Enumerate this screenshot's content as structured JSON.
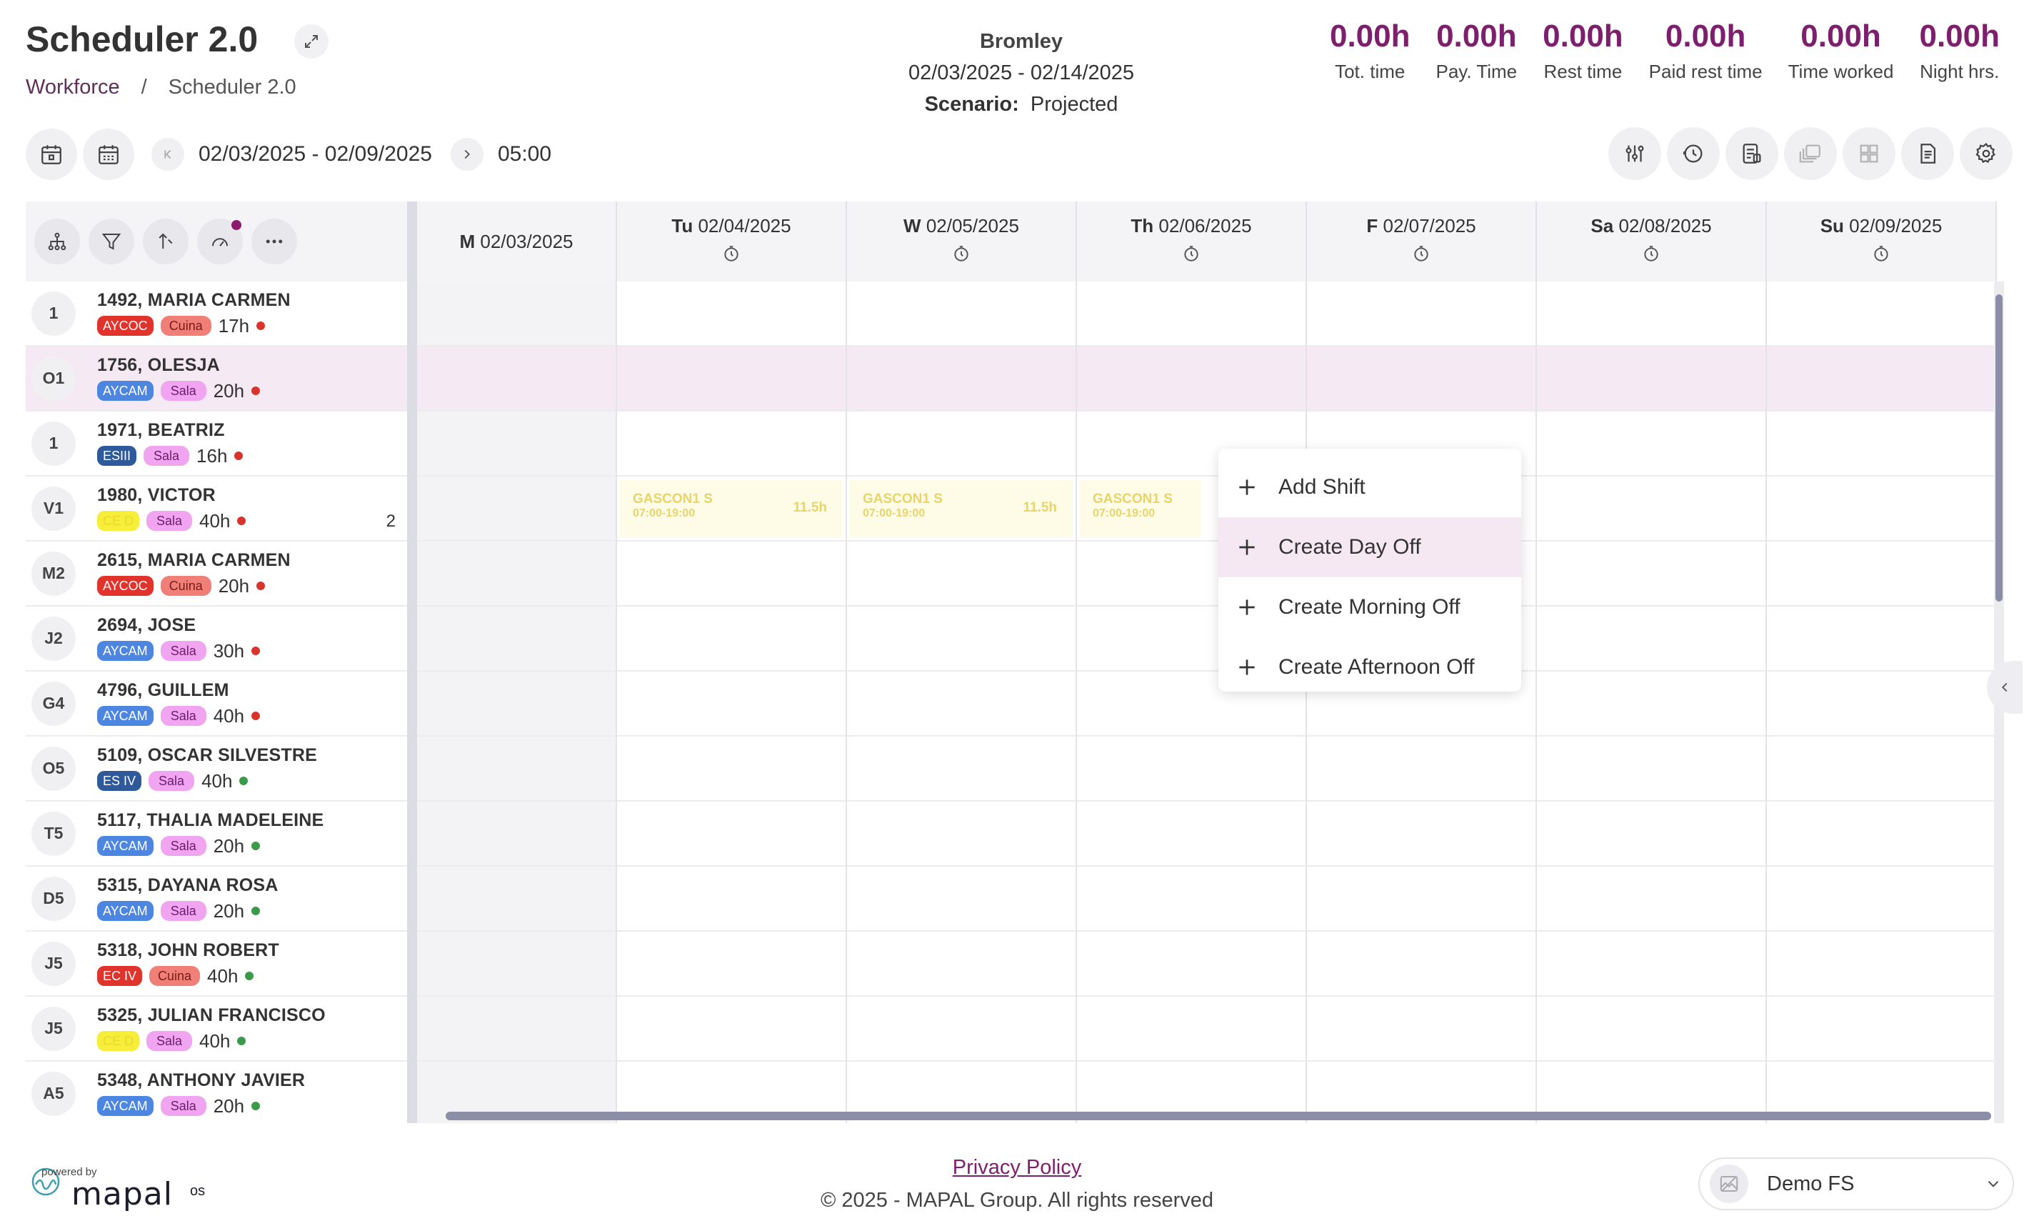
{
  "header": {
    "title": "Scheduler 2.0",
    "breadcrumb": [
      "Workforce",
      "/",
      "Scheduler 2.0"
    ],
    "location": "Bromley",
    "period": "02/03/2025 - 02/14/2025",
    "scenario_label": "Scenario:",
    "scenario_value": "Projected"
  },
  "stats": [
    {
      "value": "0.00h",
      "label": "Tot. time"
    },
    {
      "value": "0.00h",
      "label": "Pay. Time"
    },
    {
      "value": "0.00h",
      "label": "Rest time"
    },
    {
      "value": "0.00h",
      "label": "Paid rest time"
    },
    {
      "value": "0.00h",
      "label": "Time worked"
    },
    {
      "value": "0.00h",
      "label": "Night hrs."
    }
  ],
  "toolbar": {
    "week_range": "02/03/2025 - 02/09/2025",
    "time": "05:00",
    "right_icons": [
      "sliders-icon",
      "history-icon",
      "report-icon",
      "copy-icon",
      "grid-icon",
      "document-icon",
      "gear-icon"
    ]
  },
  "days": [
    {
      "abbr": "M",
      "date": "02/03/2025"
    },
    {
      "abbr": "Tu",
      "date": "02/04/2025"
    },
    {
      "abbr": "W",
      "date": "02/05/2025"
    },
    {
      "abbr": "Th",
      "date": "02/06/2025"
    },
    {
      "abbr": "F",
      "date": "02/07/2025"
    },
    {
      "abbr": "Sa",
      "date": "02/08/2025"
    },
    {
      "abbr": "Su",
      "date": "02/09/2025"
    }
  ],
  "employees": [
    {
      "initials": "1",
      "name": "1492, MARIA CARMEN",
      "tag": "AYCOC",
      "dept": "Cuina",
      "hours": "17h",
      "status": "red"
    },
    {
      "initials": "O1",
      "name": "1756, OLESJA",
      "tag": "AYCAM",
      "dept": "Sala",
      "hours": "20h",
      "status": "red"
    },
    {
      "initials": "1",
      "name": "1971, BEATRIZ",
      "tag": "ESIII",
      "dept": "Sala",
      "hours": "16h",
      "status": "red"
    },
    {
      "initials": "V1",
      "name": "1980, VICTOR",
      "tag": "CE D",
      "dept": "Sala",
      "hours": "40h",
      "status": "red",
      "extra": "2"
    },
    {
      "initials": "M2",
      "name": "2615, MARIA CARMEN",
      "tag": "AYCOC",
      "dept": "Cuina",
      "hours": "20h",
      "status": "red"
    },
    {
      "initials": "J2",
      "name": "2694, JOSE",
      "tag": "AYCAM",
      "dept": "Sala",
      "hours": "30h",
      "status": "red"
    },
    {
      "initials": "G4",
      "name": "4796, GUILLEM",
      "tag": "AYCAM",
      "dept": "Sala",
      "hours": "40h",
      "status": "red"
    },
    {
      "initials": "O5",
      "name": "5109, OSCAR SILVESTRE",
      "tag": "ES IV",
      "dept": "Sala",
      "hours": "40h",
      "status": "green"
    },
    {
      "initials": "T5",
      "name": "5117, THALIA MADELEINE",
      "tag": "AYCAM",
      "dept": "Sala",
      "hours": "20h",
      "status": "green"
    },
    {
      "initials": "D5",
      "name": "5315, DAYANA ROSA",
      "tag": "AYCAM",
      "dept": "Sala",
      "hours": "20h",
      "status": "green"
    },
    {
      "initials": "J5",
      "name": "5318, JOHN ROBERT",
      "tag": "EC IV",
      "dept": "Cuina",
      "hours": "40h",
      "status": "green"
    },
    {
      "initials": "J5",
      "name": "5325, JULIAN FRANCISCO",
      "tag": "CE D",
      "dept": "Sala",
      "hours": "40h",
      "status": "green"
    },
    {
      "initials": "A5",
      "name": "5348, ANTHONY JAVIER",
      "tag": "AYCAM",
      "dept": "Sala",
      "hours": "20h",
      "status": "green"
    }
  ],
  "shifts": [
    {
      "name": "GASCON1 S",
      "time": "07:00-19:00",
      "duration": "11.5h"
    },
    {
      "name": "GASCON1 S",
      "time": "07:00-19:00",
      "duration": "11.5h"
    },
    {
      "name": "GASCON1 S",
      "time": "07:00-19:00",
      "duration": ""
    }
  ],
  "context_menu": [
    "Add Shift",
    "Create Day Off",
    "Create Morning Off",
    "Create Afternoon Off"
  ],
  "footer": {
    "powered_by": "powered by",
    "brand": "mapal",
    "brand_suffix": "os",
    "privacy": "Privacy Policy",
    "copyright": "© 2025 - MAPAL Group. All rights reserved",
    "company": "Demo FS"
  },
  "colors": {
    "accent": "#7e1f6e",
    "status_red": "#d9342b",
    "status_green": "#3a9a4a",
    "tag_AYCOC": "#e0332b",
    "tag_AYCAM": "#4c86e0",
    "tag_ESIII": "#2e5a9c",
    "tag_ESIV": "#2e5a9c",
    "tag_ECIV": "#e0332b",
    "tag_CED": "#f7ee3a"
  }
}
